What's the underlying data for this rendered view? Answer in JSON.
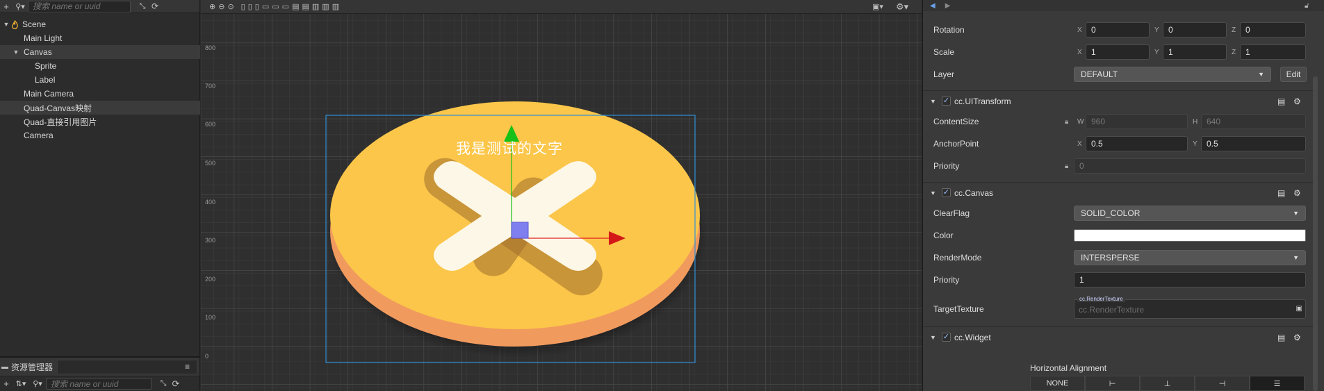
{
  "hierarchy": {
    "search_placeholder": "搜索 name or uuid",
    "nodes": [
      {
        "label": "Scene",
        "depth": 0,
        "arrow": "▼",
        "icon": true
      },
      {
        "label": "Main Light",
        "depth": 1,
        "arrow": ""
      },
      {
        "label": "Canvas",
        "depth": 1,
        "arrow": "▼",
        "selected": true
      },
      {
        "label": "Sprite",
        "depth": 2,
        "arrow": ""
      },
      {
        "label": "Label",
        "depth": 2,
        "arrow": ""
      },
      {
        "label": "Main Camera",
        "depth": 1,
        "arrow": ""
      },
      {
        "label": "Quad-Canvas映射",
        "depth": 1,
        "arrow": "",
        "selected": true
      },
      {
        "label": "Quad-直接引用图片",
        "depth": 1,
        "arrow": ""
      },
      {
        "label": "Camera",
        "depth": 1,
        "arrow": ""
      }
    ]
  },
  "assets": {
    "title": "资源管理器",
    "search_placeholder": "搜索 name or uuid"
  },
  "scene": {
    "ruler_labels": [
      "800",
      "700",
      "600",
      "500",
      "400",
      "300",
      "200",
      "100",
      "0"
    ],
    "world_text": "我是测试的文字"
  },
  "inspector": {
    "rotation": {
      "label": "Rotation",
      "x": "0",
      "y": "0",
      "z": "0"
    },
    "scale": {
      "label": "Scale",
      "x": "1",
      "y": "1",
      "z": "1"
    },
    "layer": {
      "label": "Layer",
      "value": "DEFAULT",
      "edit_label": "Edit"
    },
    "axis_x": "X",
    "axis_y": "Y",
    "axis_z": "Z",
    "axis_w": "W",
    "axis_h": "H",
    "ui_transform": {
      "title": "cc.UITransform",
      "content_size_label": "ContentSize",
      "content_w": "960",
      "content_h": "640",
      "anchor_label": "AnchorPoint",
      "anchor_x": "0.5",
      "anchor_y": "0.5",
      "priority_label": "Priority",
      "priority_value": "0"
    },
    "canvas": {
      "title": "cc.Canvas",
      "clear_flag_label": "ClearFlag",
      "clear_flag_value": "SOLID_COLOR",
      "color_label": "Color",
      "color_value": "#ffffff",
      "render_mode_label": "RenderMode",
      "render_mode_value": "INTERSPERSE",
      "priority_label": "Priority",
      "priority_value": "1",
      "target_texture_label": "TargetTexture",
      "target_texture_tag": "cc.RenderTexture",
      "target_texture_placeholder": "cc.RenderTexture"
    },
    "widget": {
      "title": "cc.Widget",
      "horizontal_alignment_label": "Horizontal Alignment",
      "none_label": "NONE"
    }
  },
  "colors": {
    "accent": "#4a90e2",
    "coin": "#fbc547",
    "coin_edge": "#f5a26a",
    "cross": "#fdf6e6",
    "axis_x": "#e02020",
    "axis_y": "#18c018"
  }
}
